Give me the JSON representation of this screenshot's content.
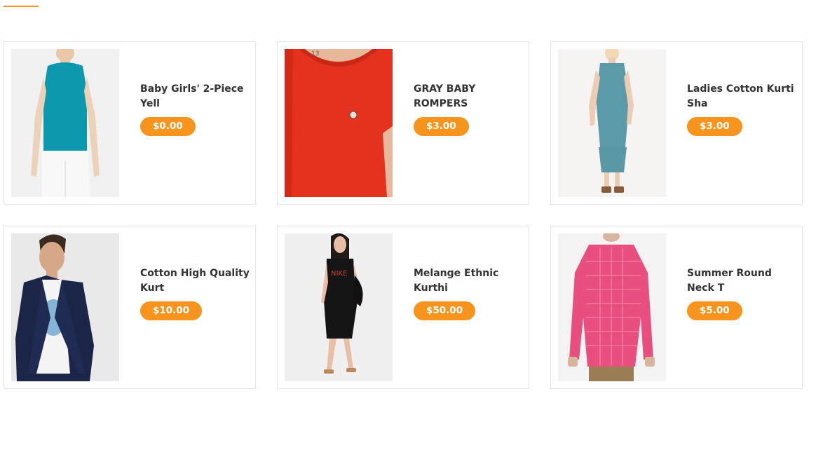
{
  "products": [
    {
      "name": "Baby Girls' 2-Piece Yell",
      "price": "$0.00",
      "image": "teal-sleeveless-top"
    },
    {
      "name": "GRAY BABY ROMPERS",
      "price": "$3.00",
      "image": "red-tshirt"
    },
    {
      "name": "Ladies Cotton Kurti Sha",
      "price": "$3.00",
      "image": "blue-dress"
    },
    {
      "name": "Cotton High Quality Kurt",
      "price": "$10.00",
      "image": "navy-blazer"
    },
    {
      "name": "Melange Ethnic Kurthi",
      "price": "$50.00",
      "image": "black-dress"
    },
    {
      "name": "Summer Round Neck T",
      "price": "$5.00",
      "image": "pink-check-shirt"
    }
  ],
  "colors": {
    "accent": "#f7941d",
    "border": "#e4e4e4",
    "text": "#333333"
  }
}
